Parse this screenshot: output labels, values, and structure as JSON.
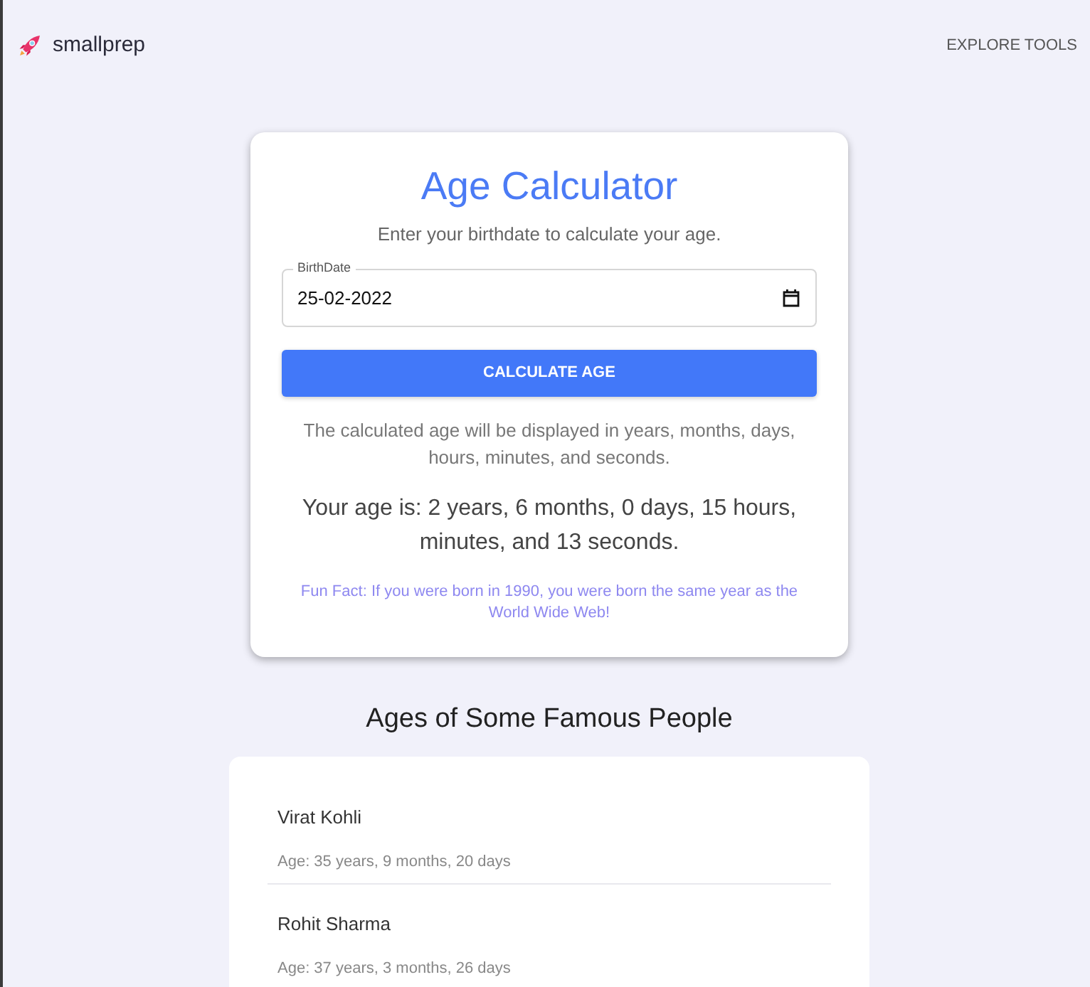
{
  "header": {
    "logo_text": "smallprep",
    "nav_link": "EXPLORE TOOLS"
  },
  "calculator": {
    "title": "Age Calculator",
    "subtitle": "Enter your birthdate to calculate your age.",
    "birthdate_field": {
      "label": "BirthDate",
      "value": "25-02-2022"
    },
    "button": "CALCULATE AGE",
    "description": "The calculated age will be displayed in years, months, days, hours, minutes, and seconds.",
    "result": "Your age is: 2 years, 6 months, 0 days, 15 hours, minutes, and 13 seconds.",
    "fun_fact": "Fun Fact: If you were born in 1990, you were born the same year as the World Wide Web!"
  },
  "famous_people": {
    "title": "Ages of Some Famous People",
    "people": [
      {
        "name": "Virat Kohli",
        "age": "Age: 35 years, 9 months, 20 days"
      },
      {
        "name": "Rohit Sharma",
        "age": "Age: 37 years, 3 months, 26 days"
      }
    ]
  }
}
